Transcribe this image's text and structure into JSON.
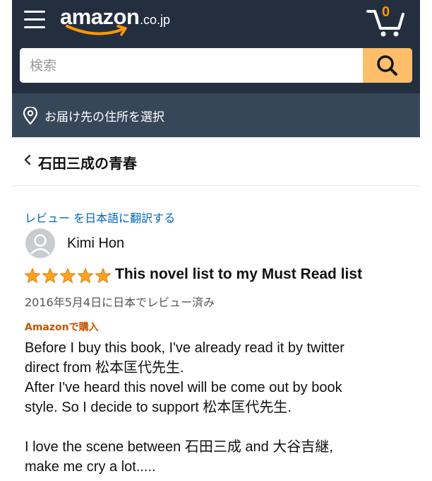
{
  "header": {
    "logo_word": "amazon",
    "logo_suffix": ".co.jp",
    "cart_count": "0"
  },
  "search": {
    "placeholder": "検索"
  },
  "delivery": {
    "label": "お届け先の住所を選択"
  },
  "breadcrumb": {
    "title": "石田三成の青春"
  },
  "review": {
    "translate_link": "レビュー を日本語に翻訳する",
    "reviewer_name": "Kimi Hon",
    "rating": 5,
    "rating_max": 5,
    "title": "This novel list to my Must Read list",
    "date": "2016年5月4日に日本でレビュー済み",
    "verified_label": "Amazonで購入",
    "body_lines": [
      "Before I buy this book, I've already read it by twitter",
      "direct from 松本匡代先生.",
      "After I've heard this novel will be come out by book",
      "style. So I decide to support 松本匡代先生.",
      "",
      "I love the scene between 石田三成 and 大谷吉継,",
      "make me cry a lot....."
    ]
  },
  "colors": {
    "header_bg": "#232f3e",
    "subheader_bg": "#37475a",
    "accent": "#ff9900",
    "search_button": "#febd69",
    "link": "#0066c0",
    "verified": "#c45500",
    "star": "#ffa41c"
  },
  "icons": [
    "menu-icon",
    "cart-icon",
    "search-icon",
    "location-pin-icon",
    "chevron-left-icon",
    "user-silhouette-icon",
    "star-icon"
  ]
}
